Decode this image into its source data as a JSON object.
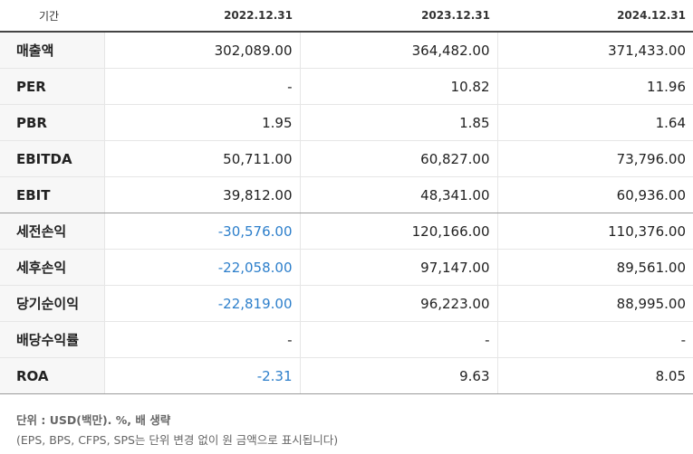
{
  "table": {
    "header": {
      "label": "기간",
      "periods": [
        "2022.12.31",
        "2023.12.31",
        "2024.12.31"
      ]
    },
    "rows": [
      {
        "label": "매출액",
        "values": [
          "302,089.00",
          "364,482.00",
          "371,433.00"
        ],
        "negative": [
          false,
          false,
          false
        ]
      },
      {
        "label": "PER",
        "values": [
          "-",
          "10.82",
          "11.96"
        ],
        "negative": [
          false,
          false,
          false
        ]
      },
      {
        "label": "PBR",
        "values": [
          "1.95",
          "1.85",
          "1.64"
        ],
        "negative": [
          false,
          false,
          false
        ]
      },
      {
        "label": "EBITDA",
        "values": [
          "50,711.00",
          "60,827.00",
          "73,796.00"
        ],
        "negative": [
          false,
          false,
          false
        ]
      },
      {
        "label": "EBIT",
        "values": [
          "39,812.00",
          "48,341.00",
          "60,936.00"
        ],
        "negative": [
          false,
          false,
          false
        ]
      },
      {
        "label": "세전손익",
        "values": [
          "-30,576.00",
          "120,166.00",
          "110,376.00"
        ],
        "negative": [
          true,
          false,
          false
        ]
      },
      {
        "label": "세후손익",
        "values": [
          "-22,058.00",
          "97,147.00",
          "89,561.00"
        ],
        "negative": [
          true,
          false,
          false
        ]
      },
      {
        "label": "당기순이익",
        "values": [
          "-22,819.00",
          "96,223.00",
          "88,995.00"
        ],
        "negative": [
          true,
          false,
          false
        ]
      },
      {
        "label": "배당수익률",
        "values": [
          "-",
          "-",
          "-"
        ],
        "negative": [
          false,
          false,
          false
        ]
      },
      {
        "label": "ROA",
        "values": [
          "-2.31",
          "9.63",
          "8.05"
        ],
        "negative": [
          true,
          false,
          false
        ]
      }
    ]
  },
  "notes": {
    "unit": "단위 : USD(백만). %, 배 생략",
    "detail": "(EPS, BPS, CFPS, SPS는 단위 변경 없이 원 금액으로 표시됩니다)"
  },
  "colors": {
    "negative_value": "#2d7fcb",
    "label_bg": "#f7f7f7"
  }
}
